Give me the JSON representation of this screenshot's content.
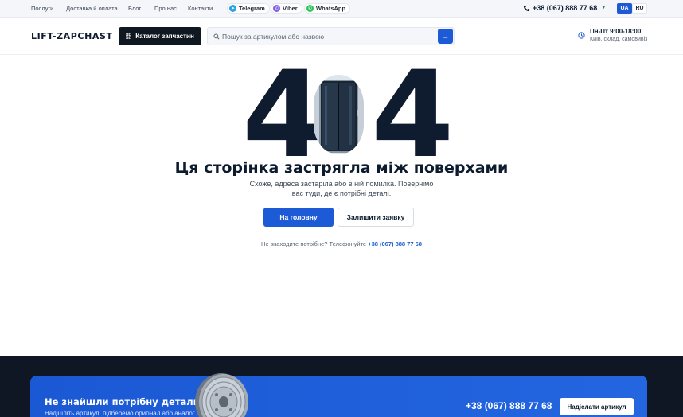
{
  "topbar": {
    "nav": [
      "Послуги",
      "Доставка й оплата",
      "Блог",
      "Про нас",
      "Контакти"
    ],
    "messengers": [
      {
        "label": "Telegram",
        "icon": "telegram-icon",
        "color": "#2aa3e0"
      },
      {
        "label": "Viber",
        "icon": "viber-icon",
        "color": "#7d5ee5"
      },
      {
        "label": "WhatsApp",
        "icon": "whatsapp-icon",
        "color": "#2cc45a"
      }
    ],
    "phone": "+38 (067) 888 77 68",
    "languages": {
      "active": "UA",
      "other": "RU"
    }
  },
  "header": {
    "logo": "LIFT-ZAPCHAST",
    "catalog_label": "Каталог запчастин",
    "search_placeholder": "Пошук за артикулом або назвою",
    "hours_title": "Пн-Пт 9:00-18:00",
    "hours_sub": "Київ, склад, самовивіз"
  },
  "error": {
    "digit_left": "4",
    "digit_right": "4",
    "headline": "Ця сторінка застрягла між поверхами",
    "subtext": "Схоже, адреса застаріла або в ній помилка. Повернімо вас туди, де є потрібні деталі.",
    "home_button": "На головну",
    "request_button": "Залишити заявку",
    "help_text": "Не знаходите потрібне? Телефонуйте",
    "help_phone": "+38 (067) 888 77 68"
  },
  "cta": {
    "title": "Не знайшли потрібну деталь?",
    "subtitle": "Надішліть артикул, підберемо оригінал або аналог",
    "phone": "+38 (067) 888 77 68",
    "button": "Надіслати артикул"
  },
  "colors": {
    "accent": "#1d5bd6",
    "dark": "#0f1720",
    "heading": "#0d1b2e"
  }
}
